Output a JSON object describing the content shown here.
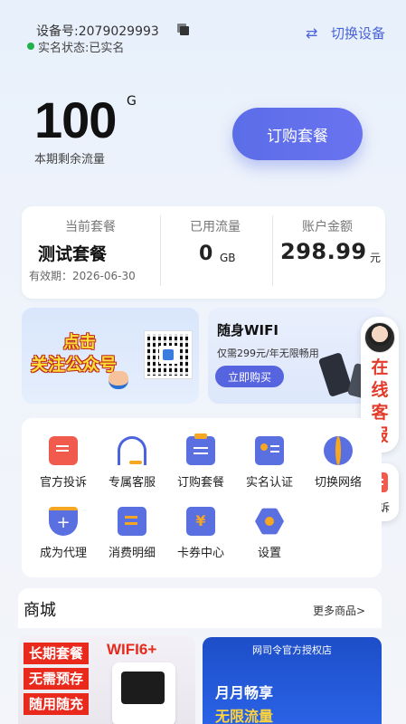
{
  "header": {
    "device_line": "设备号:2079029993",
    "status_line": "实名状态:已实名",
    "switch_label": "切换设备"
  },
  "data_usage": {
    "remaining_value": "100",
    "remaining_unit": "G",
    "remaining_label": "本期剩余流量",
    "buy_button": "订购套餐"
  },
  "info": {
    "plan_title": "当前套餐",
    "plan_name": "测试套餐",
    "plan_valid": "有效期：2026-06-30",
    "used_title": "已用流量",
    "used_value": "0",
    "used_unit": "GB",
    "balance_title": "账户金额",
    "balance_value": "298.99",
    "balance_unit": "元"
  },
  "promo_left": {
    "line1": "点击",
    "line2": "关注公众号"
  },
  "promo_right": {
    "title": "随身WIFI",
    "subtitle": "仅需299元/年无限畅用",
    "button": "立即购买"
  },
  "float": {
    "cs_text": "在线客服",
    "complain": "投诉"
  },
  "menu": {
    "items": [
      {
        "label": "官方投诉"
      },
      {
        "label": "专属客服"
      },
      {
        "label": "订购套餐"
      },
      {
        "label": "实名认证"
      },
      {
        "label": "切换网络"
      },
      {
        "label": "成为代理"
      },
      {
        "label": "消费明细"
      },
      {
        "label": "卡券中心"
      },
      {
        "label": "设置"
      }
    ]
  },
  "shop": {
    "title": "商城",
    "more": "更多商品>",
    "card1": {
      "tag1": "长期套餐",
      "tag2": "无需预存",
      "tag3": "随用随充",
      "badge": "WIFI6+"
    },
    "card2": {
      "auth": "网司令官方授权店",
      "line1": "月月畅享",
      "line2": "无限流量"
    }
  },
  "colors": {
    "accent": "#5b6de8",
    "red": "#e8291c",
    "orange": "#f5a623"
  }
}
